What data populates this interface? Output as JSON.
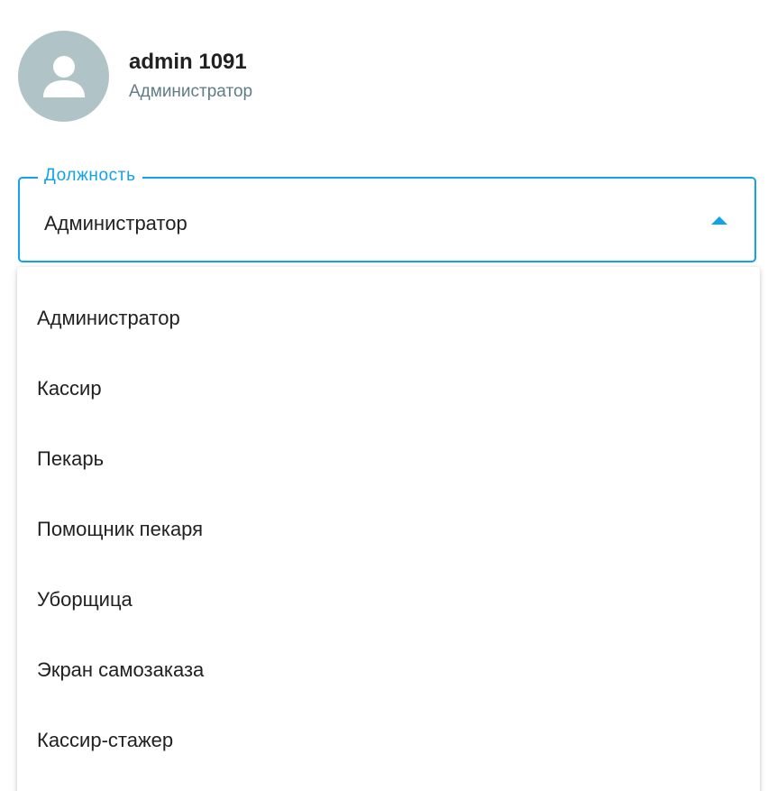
{
  "user": {
    "name": "admin 1091",
    "role": "Администратор",
    "avatar_icon": "person-icon"
  },
  "position_select": {
    "label": "Должность",
    "value": "Администратор",
    "caret_icon": "caret-up-icon",
    "options": [
      "Администратор",
      "Кассир",
      "Пекарь",
      "Помощник пекаря",
      "Уборщица",
      "Экран самозаказа",
      "Кассир-стажер"
    ]
  },
  "colors": {
    "accent": "#12a2e8",
    "avatar_bg": "#b0c4c8",
    "secondary_text": "#5f7d86",
    "primary_text": "#212121"
  }
}
